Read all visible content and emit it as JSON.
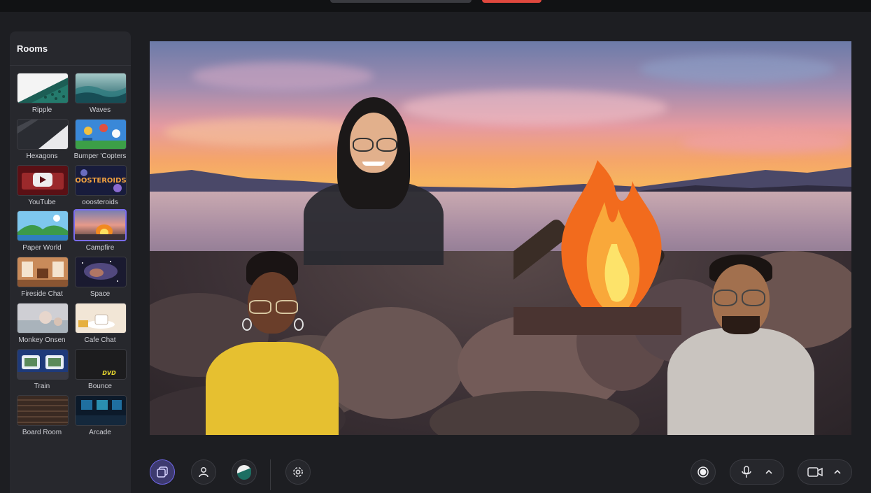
{
  "sidebar": {
    "title": "Rooms",
    "rooms": [
      {
        "label": "Ripple",
        "selected": false
      },
      {
        "label": "Waves",
        "selected": false
      },
      {
        "label": "Hexagons",
        "selected": false
      },
      {
        "label": "Bumper 'Copters",
        "selected": false
      },
      {
        "label": "YouTube",
        "selected": false
      },
      {
        "label": "ooosteroids",
        "selected": false
      },
      {
        "label": "Paper World",
        "selected": false
      },
      {
        "label": "Campfire",
        "selected": true
      },
      {
        "label": "Fireside Chat",
        "selected": false
      },
      {
        "label": "Space",
        "selected": false
      },
      {
        "label": "Monkey Onsen",
        "selected": false
      },
      {
        "label": "Cafe Chat",
        "selected": false
      },
      {
        "label": "Train",
        "selected": false
      },
      {
        "label": "Bounce",
        "selected": false
      },
      {
        "label": "Board Room",
        "selected": false
      },
      {
        "label": "Arcade",
        "selected": false
      }
    ],
    "thumb_texts": {
      "oosteroids": "OOSTEROIDS",
      "bounce": "DVD"
    }
  },
  "toolbar": {
    "left_icons": [
      "rooms-icon",
      "person-icon",
      "background-icon",
      "settings-icon"
    ],
    "right_icons": [
      "record-icon",
      "microphone-icon",
      "chevron-up-icon",
      "camera-icon",
      "chevron-up-icon"
    ]
  },
  "colors": {
    "accent": "#7a6cf0",
    "record_top": "#e0483e",
    "panel": "#27282d",
    "background": "#1d1e22"
  }
}
